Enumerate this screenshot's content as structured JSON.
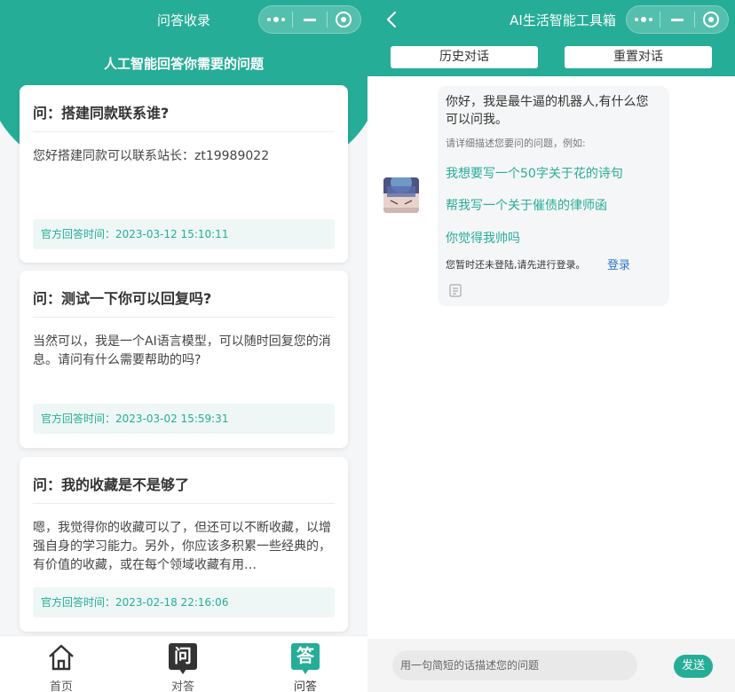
{
  "left": {
    "title": "问答收录",
    "subtitle": "人工智能回答你需要的问题",
    "cards": [
      {
        "question": "问：搭建同款联系谁?",
        "answer": "您好搭建同款可以联系站长：zt19989022",
        "answer_time": "官方回答时间：2023-03-12 15:10:11"
      },
      {
        "question": "问：测试一下你可以回复吗?",
        "answer": "当然可以，我是一个AI语言模型，可以随时回复您的消息。请问有什么需要帮助的吗?",
        "answer_time": "官方回答时间：2023-03-02 15:59:31"
      },
      {
        "question": "问：我的收藏是不是够了",
        "answer": "嗯，我觉得你的收藏可以了，但还可以不断收藏，以增强自身的学习能力。另外，你应该多积累一些经典的，有价值的收藏，或在每个领域收藏有用…",
        "answer_time": "官方回答时间：2023-02-18 22:16:06"
      }
    ],
    "tabbar": {
      "home": {
        "label": "首页"
      },
      "chat": {
        "label": "对答",
        "glyph": "问"
      },
      "qa": {
        "label": "问答",
        "glyph": "答"
      }
    }
  },
  "right": {
    "title": "AI生活智能工具箱",
    "history_button": "历史对话",
    "reset_button": "重置对话",
    "message": {
      "greeting": "你好，我是最牛逼的机器人,有什么您可以问我。",
      "hint": "请详细描述您要问的问题，例如:",
      "suggestions": [
        "我想要写一个50字关于花的诗句",
        "帮我写一个关于催债的律师函",
        "你觉得我帅吗"
      ],
      "login_notice": "您暂时还未登陆,请先进行登录。",
      "login_link": "登录"
    },
    "input": {
      "placeholder": "用一句简短的话描述您的问题"
    },
    "send_button": "发送"
  },
  "colors": {
    "accent": "#26ad97",
    "link": "#2a79c9",
    "tab_icon_dark": "#333333"
  }
}
